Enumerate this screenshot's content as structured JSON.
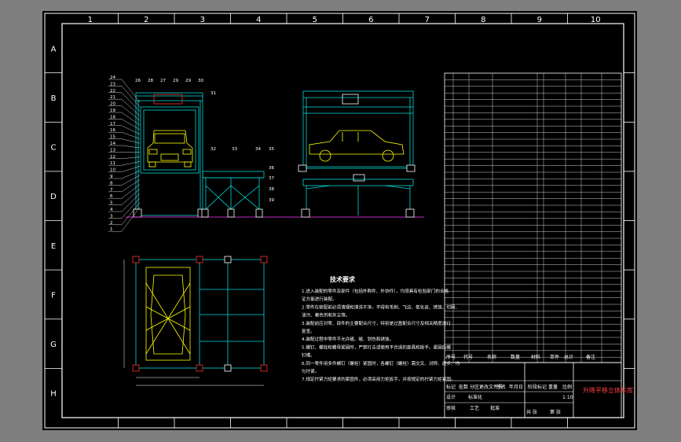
{
  "drawing": {
    "frame_colors": {
      "outer": "#ffffff",
      "inner": "#ffffff",
      "background": "#000000",
      "part_lines": "#00d8d8",
      "car": "#ffff00",
      "accent": "#ff3030",
      "table_text": "#ff40ff"
    },
    "zone_numbers": [
      "1",
      "2",
      "3",
      "4",
      "5",
      "6",
      "7",
      "8",
      "9",
      "10"
    ],
    "zone_letters": [
      "A",
      "B",
      "C",
      "D",
      "E",
      "F",
      "G",
      "H"
    ],
    "leader_labels_left": [
      "24",
      "23",
      "22",
      "21",
      "20",
      "19",
      "18",
      "17",
      "16",
      "15",
      "14",
      "13",
      "12",
      "11",
      "10",
      "9",
      "8",
      "7",
      "6",
      "5",
      "4",
      "3",
      "2",
      "1"
    ],
    "leader_labels_top": [
      "26",
      "28",
      "27",
      "29",
      "29",
      "30"
    ],
    "leader_labels_right": [
      "31",
      "32",
      "33",
      "34",
      "35",
      "36",
      "37",
      "38",
      "39"
    ],
    "notes_title": "技术要求",
    "notes": [
      "1.进入装配的零件及部件（包括外购件、外协件），均须具有检验部门的合格",
      "  证方能进行装配。",
      "2.零件在装配前必须清理和清洗干净，不得有毛刺、飞边、氧化皮、锈蚀、切屑、",
      "  油污、着色剂和灰尘等。",
      "3.装配前应对零、部件的主要配合尺寸，特别是过盈配合尺寸及相关精度进行",
      "  复查。",
      "4.装配过程中零件不允许磕、碰、划伤和锈蚀。",
      "5.螺钉、螺栓和螺母紧固时，严禁打击或使用不合适的旋具和扳手。紧固后螺",
      "  钉槽。",
      "6.同一零件用多件螺钉（螺栓）紧固时，各螺钉（螺栓）需交叉、对称、逐步、均",
      "  匀拧紧。",
      "7.规定拧紧力矩要求的紧固件，必须采用力矩扳手，并按规定的拧紧力矩紧固。"
    ],
    "title_block": {
      "drawing_name": "升降平移立体车库",
      "header_cells": [
        "序号",
        "代号",
        "名称",
        "数量",
        "材料",
        "单件",
        "总计",
        "备注"
      ],
      "cells": [
        "标记",
        "处数",
        "分区",
        "更改文件号",
        "签名",
        "年月日",
        "设计",
        "标准化",
        "阶段标记",
        "重量",
        "比例",
        "审核",
        "工艺",
        "批准",
        "共 张",
        "第 张",
        "1:10"
      ]
    }
  }
}
